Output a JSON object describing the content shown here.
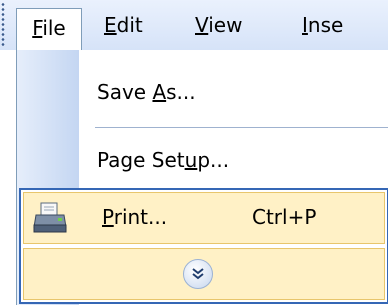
{
  "menubar": {
    "items": [
      {
        "label": "File",
        "accel_index": 0
      },
      {
        "label": "Edit",
        "accel_index": 0
      },
      {
        "label": "View",
        "accel_index": 0
      },
      {
        "label": "Inse",
        "accel_index": 0
      }
    ]
  },
  "file_menu": {
    "items": [
      {
        "label_pre": "Save ",
        "label_u": "A",
        "label_post": "s..."
      },
      {
        "label_pre": "Page Set",
        "label_u": "u",
        "label_post": "p..."
      },
      {
        "label_pre": "",
        "label_u": "P",
        "label_post": "rint...",
        "shortcut": "Ctrl+P",
        "icon": "printer-icon"
      }
    ],
    "expand_icon": "chevron-double-down-icon"
  },
  "colors": {
    "highlight_bg": "#fff1c6",
    "highlight_border": "#3567b5"
  }
}
